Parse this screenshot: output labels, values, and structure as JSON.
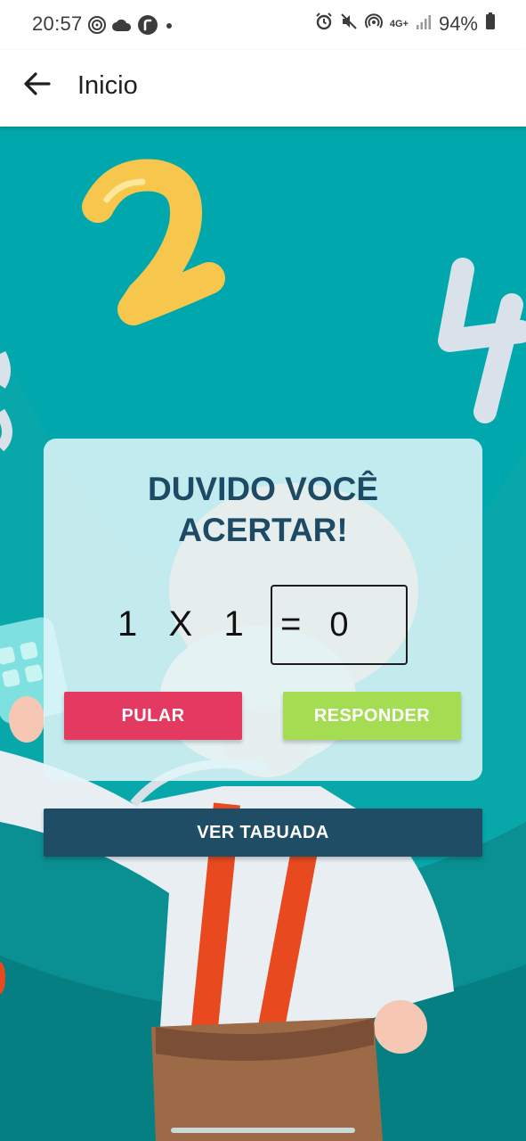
{
  "status_bar": {
    "time": "20:57",
    "battery": "94%",
    "network": "4G+",
    "icons_left": [
      "fingerprint-icon",
      "cloud-icon",
      "app-badge-icon",
      "dot-icon"
    ],
    "icons_right": [
      "alarm-icon",
      "mute-icon",
      "hotspot-icon",
      "network-icon",
      "signal-icon",
      "battery-icon"
    ]
  },
  "app_bar": {
    "title": "Inicio",
    "back_icon": "arrow-left-icon"
  },
  "quiz": {
    "title": "DUVIDO VOCÊ ACERTAR!",
    "operand_a": "1",
    "operator": "X",
    "operand_b": "1",
    "equals": "=",
    "answer_value": "0"
  },
  "buttons": {
    "skip_label": "PULAR",
    "answer_label": "RESPONDER",
    "table_label": "VER TABUADA"
  },
  "colors": {
    "background_teal": "#00a8ad",
    "title_navy": "#1d4b66",
    "skip_red": "#e43a62",
    "answer_green": "#a4dd52",
    "table_navy": "#1f4d65"
  }
}
